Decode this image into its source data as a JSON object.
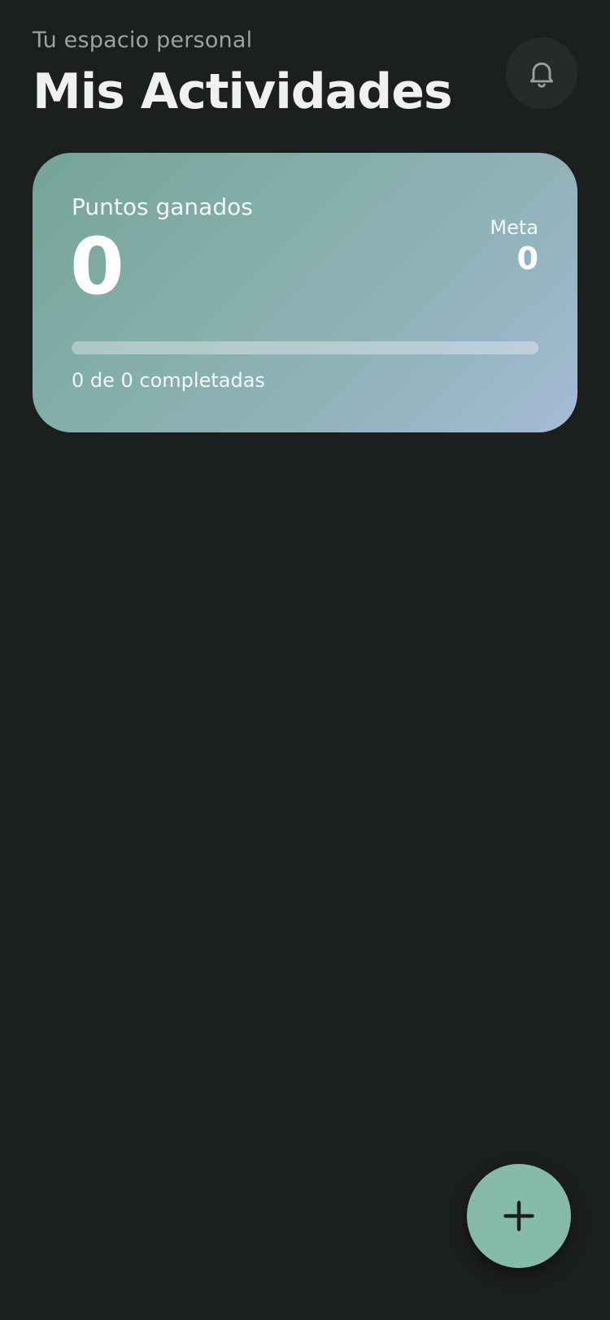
{
  "header": {
    "subtitle": "Tu espacio personal",
    "title": "Mis Actividades",
    "notification_icon": "bell-icon"
  },
  "summary_card": {
    "points_label": "Puntos ganados",
    "points_value": "0",
    "goal_label": "Meta",
    "goal_value": "0",
    "progress_fraction": 0,
    "progress_text": "0 de 0 completadas"
  },
  "fab": {
    "icon": "plus-icon"
  },
  "colors": {
    "background": "#1b1f1d",
    "card_gradient_start": "#74a497",
    "card_gradient_end": "#a6bcd6",
    "fab": "#86bba9",
    "title_text": "#eef1ee",
    "subtitle_text": "#9ca39f"
  }
}
